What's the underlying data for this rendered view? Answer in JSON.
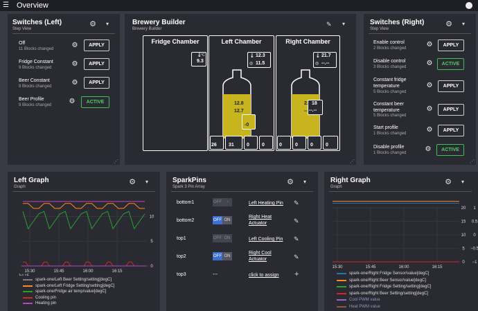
{
  "topbar": {
    "title": "Overview"
  },
  "switches_left": {
    "title": "Switches (Left)",
    "subtitle": "Step View",
    "rows": [
      {
        "name": "Off",
        "sub": "11 Blocks changed",
        "button": "APPLY"
      },
      {
        "name": "Fridge Constant",
        "sub": "9 Blocks changed",
        "button": "APPLY"
      },
      {
        "name": "Beer Constant",
        "sub": "9 Blocks changed",
        "button": "APPLY"
      },
      {
        "name": "Beer Profile",
        "sub": "9 Blocks changed",
        "button": "ACTIVE"
      }
    ]
  },
  "brewery": {
    "title": "Brewery Builder",
    "subtitle": "Brewery Builder",
    "fridge": {
      "name": "Fridge Chamber",
      "temp": "9.3",
      "unit": "°C"
    },
    "left": {
      "name": "Left Chamber",
      "sensor1": "12.3",
      "sensor2": "11.5",
      "unit": "°C",
      "beer1": "12.8",
      "beer2": "12.7",
      "pct": "-0",
      "bottom": [
        "26",
        "31",
        "0",
        "0"
      ]
    },
    "right": {
      "name": "Right Chamber",
      "sensor1": "21.7",
      "sensor2": "--.--",
      "unit": "°C",
      "beer1": "22.4",
      "beer2": "--.--",
      "top3a": "18",
      "top3b": "--.--",
      "bottom": [
        "0",
        "0",
        "0",
        "0"
      ]
    }
  },
  "switches_right": {
    "title": "Switches (Right)",
    "subtitle": "Step View",
    "rows": [
      {
        "name": "Enable control",
        "sub": "2 Blocks changed",
        "button": "APPLY"
      },
      {
        "name": "Disable control",
        "sub": "3 Blocks changed",
        "button": "ACTIVE"
      },
      {
        "name": "Constant fridge temperature",
        "sub": "5 Blocks changed",
        "button": "APPLY"
      },
      {
        "name": "Constant beer temperature",
        "sub": "5 Blocks changed",
        "button": "APPLY"
      },
      {
        "name": "Start profile",
        "sub": "1 Blocks changed",
        "button": "APPLY"
      },
      {
        "name": "Disable profile",
        "sub": "1 Blocks changed",
        "button": "ACTIVE"
      }
    ]
  },
  "left_graph": {
    "title": "Left Graph",
    "subtitle": "Graph",
    "xticks": [
      "15:30",
      "15:45",
      "16:00",
      "16:15"
    ],
    "xdate": "Jul 15",
    "yticks": [
      "10",
      "5",
      "0"
    ],
    "legend": [
      {
        "label": "spark-one/Left Beer Setting/setting[degC]",
        "color": "#7f7f7f"
      },
      {
        "label": "spark-one/Left Fridge Setting/setting[degC]",
        "color": "#ff8c1a"
      },
      {
        "label": "spark-one/Fridge air temp/value[degC]",
        "color": "#2ca02c"
      },
      {
        "label": "Cooling pin",
        "color": "#d62728"
      },
      {
        "label": "Heating pin",
        "color": "#c040c0"
      }
    ]
  },
  "sparkpins": {
    "title": "SparkPins",
    "subtitle": "Spark 3 Pin Array",
    "pins": [
      {
        "name": "bottom1",
        "state": "OFF",
        "link": "Left Heating Pin"
      },
      {
        "name": "bottom2",
        "state": "ON",
        "link": "Right Heat Actuator"
      },
      {
        "name": "top1",
        "state": "OFF",
        "link": "Left Cooling Pin"
      },
      {
        "name": "top2",
        "state": "ON",
        "link": "Right Cool Actuator"
      },
      {
        "name": "top3",
        "state": "---",
        "link": "click to assign"
      }
    ],
    "off_label": "OFF",
    "on_label": "ON"
  },
  "right_graph": {
    "title": "Right Graph",
    "subtitle": "Graph",
    "xticks": [
      "15:30",
      "15:45",
      "16:00",
      "16:15"
    ],
    "yticks_left": [
      "20",
      "15",
      "10",
      "5",
      "0"
    ],
    "yticks_right": [
      "1",
      "0.5",
      "0",
      "−0.5",
      "−1"
    ],
    "legend": [
      {
        "label": "spark-one/Right Fridge Sensor/value[degC]",
        "color": "#1f77b4"
      },
      {
        "label": "spark-one/Right Beer Sensor/value[degC]",
        "color": "#ff8c1a"
      },
      {
        "label": "spark-one/Right Fridge Setting/setting[degC]",
        "color": "#2ca02c"
      },
      {
        "label": "spark-one/Right Beer Setting/setting[degC]",
        "color": "#d62728"
      },
      {
        "label": "Cool PWM value",
        "color": "#9467bd"
      },
      {
        "label": "Heat PWM value",
        "color": "#8c564b"
      }
    ]
  },
  "chart_data": [
    {
      "type": "line",
      "title": "Left Graph",
      "x": [
        "15:30",
        "15:45",
        "16:00",
        "16:15"
      ],
      "ylim": [
        0,
        12
      ],
      "series": [
        {
          "name": "spark-one/Left Beer Setting/setting[degC]",
          "values": [
            13,
            13,
            13,
            13
          ]
        },
        {
          "name": "spark-one/Left Fridge Setting/setting[degC]",
          "values": [
            12,
            12,
            12,
            12
          ]
        },
        {
          "name": "spark-one/Fridge air temp/value[degC]",
          "values": [
            6,
            11,
            5,
            11
          ]
        },
        {
          "name": "Cooling pin",
          "values": [
            0,
            1,
            0,
            1
          ]
        },
        {
          "name": "Heating pin",
          "values": [
            0,
            0,
            0,
            0
          ]
        }
      ]
    },
    {
      "type": "line",
      "title": "Right Graph",
      "x": [
        "15:30",
        "15:45",
        "16:00",
        "16:15"
      ],
      "ylim": [
        0,
        20
      ],
      "series": [
        {
          "name": "spark-one/Right Fridge Sensor/value[degC]",
          "values": [
            21.7,
            21.7,
            21.7,
            21.7
          ]
        },
        {
          "name": "spark-one/Right Beer Sensor/value[degC]",
          "values": [
            22.4,
            22.4,
            22.4,
            22.4
          ]
        },
        {
          "name": "spark-one/Right Fridge Setting/setting[degC]",
          "values": [
            0,
            0,
            0,
            0
          ]
        },
        {
          "name": "spark-one/Right Beer Setting/setting[degC]",
          "values": [
            0,
            0,
            0,
            0
          ]
        }
      ]
    }
  ]
}
